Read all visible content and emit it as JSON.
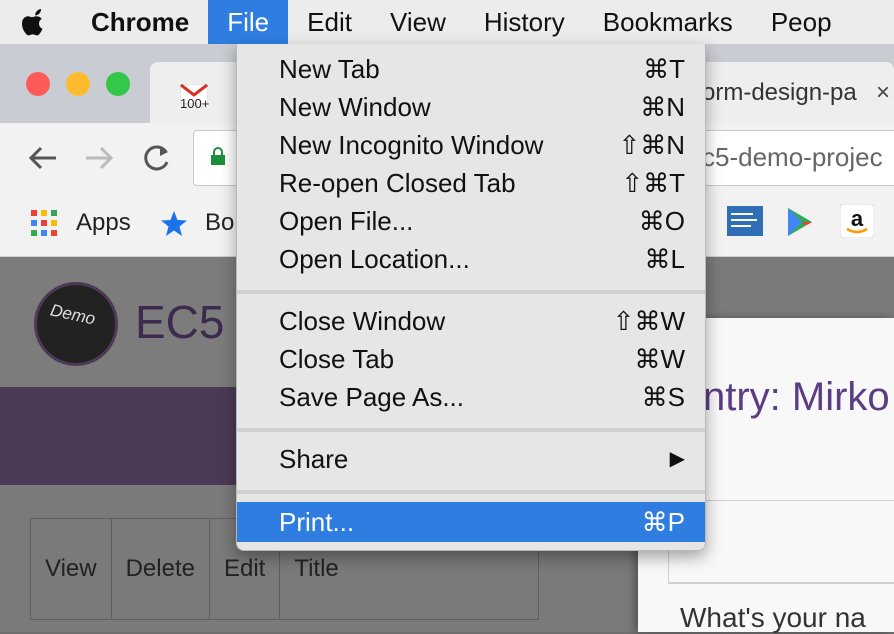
{
  "menubar": {
    "app": "Chrome",
    "items": [
      "File",
      "Edit",
      "View",
      "History",
      "Bookmarks",
      "Peop"
    ]
  },
  "browser": {
    "tab_gmail_badge": "100+",
    "tab_title": "orm-design-pa",
    "tab_close": "×",
    "url_partial": "c5-demo-projec",
    "bookmarks": {
      "apps_label": "Apps",
      "bo_label": "Bo"
    }
  },
  "page": {
    "logo_text": "Demo",
    "site_title": "EC5",
    "table_headers": [
      "View",
      "Delete",
      "Edit",
      "Title"
    ],
    "panel_heading": "ntry: Mirko",
    "panel_question": "What's your na"
  },
  "file_menu": {
    "items": [
      {
        "label": "New Tab",
        "shortcut": "⌘T"
      },
      {
        "label": "New Window",
        "shortcut": "⌘N"
      },
      {
        "label": "New Incognito Window",
        "shortcut": "⇧⌘N"
      },
      {
        "label": "Re-open Closed Tab",
        "shortcut": "⇧⌘T"
      },
      {
        "label": "Open File...",
        "shortcut": "⌘O"
      },
      {
        "label": "Open Location...",
        "shortcut": "⌘L"
      },
      {
        "label": "Close Window",
        "shortcut": "⇧⌘W"
      },
      {
        "label": "Close Tab",
        "shortcut": "⌘W"
      },
      {
        "label": "Save Page As...",
        "shortcut": "⌘S"
      },
      {
        "label": "Share",
        "shortcut": "▶"
      },
      {
        "label": "Print...",
        "shortcut": "⌘P"
      }
    ]
  },
  "colors": {
    "menu_highlight": "#2f7de0",
    "purple_band": "#4b3a55",
    "heading_purple": "#5a3d85"
  }
}
